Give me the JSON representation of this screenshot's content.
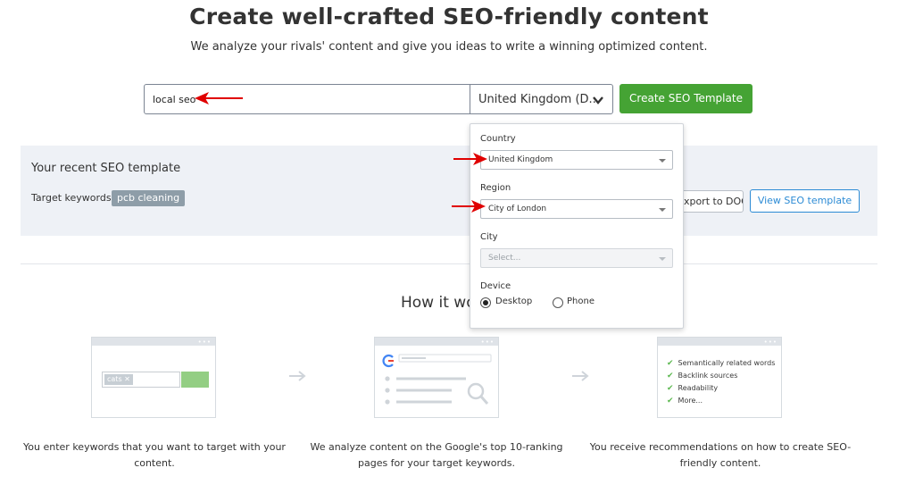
{
  "header": {
    "title": "Create well-crafted SEO-friendly content",
    "subtitle": "We analyze your rivals' content and give you ideas to write a winning optimized content."
  },
  "search": {
    "keyword_value": "local seo",
    "country_value": "United Kingdom (D...",
    "create_label": "Create SEO Template"
  },
  "recent": {
    "title": "Your recent SEO template",
    "target_label": "Target keywords:",
    "keyword_tag": "pcb cleaning",
    "export_label": "Export to DOC",
    "view_label": "View SEO template"
  },
  "dropdown": {
    "country_label": "Country",
    "country_value": "United Kingdom",
    "region_label": "Region",
    "region_value": "City of London",
    "city_label": "City",
    "city_placeholder": "Select...",
    "device_label": "Device",
    "device_desktop": "Desktop",
    "device_phone": "Phone",
    "selected_device": "Desktop"
  },
  "how": {
    "title": "How it works",
    "card1_chip": "cats",
    "card3_items": [
      "Semantically related words",
      "Backlink sources",
      "Readability",
      "More..."
    ],
    "captions": [
      "You enter keywords that you want to target with your content.",
      "We analyze content on the Google's top 10-ranking pages for your target keywords.",
      "You receive recommendations on how to create SEO-friendly content."
    ]
  },
  "icons": {
    "dropdown_chevron": "chevron-down-icon",
    "step_arrow": "arrow-right-icon",
    "annotation_arrow": "red-arrow-icon",
    "google": "google-g-icon",
    "magnifier": "search-icon",
    "check": "check-icon"
  },
  "colors": {
    "primary_green": "#45a334",
    "link_blue": "#2c8bd5",
    "panel_bg": "#eef1f6",
    "annotation_red": "#e00000"
  }
}
